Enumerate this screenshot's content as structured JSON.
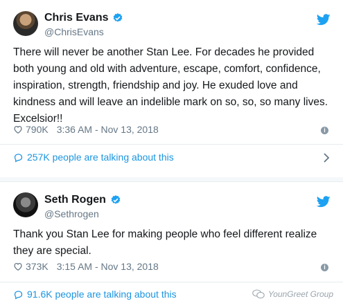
{
  "tweets": [
    {
      "name": "Chris Evans",
      "handle": "@ChrisEvans",
      "text": "There will never be another Stan Lee. For decades he provided both young and old with adventure, escape, comfort, confidence, inspiration, strength, friendship and joy. He exuded love and kindness and will leave an indelible mark on so, so, so many lives. Excelsior!!",
      "likes": "790K",
      "timestamp": "3:36 AM - Nov 13, 2018",
      "talking": "257K people are talking about this"
    },
    {
      "name": "Seth Rogen",
      "handle": "@Sethrogen",
      "text": "Thank you Stan Lee for making people who feel different realize they are special.",
      "likes": "373K",
      "timestamp": "3:15 AM - Nov 13, 2018",
      "talking": "91.6K people are talking about this"
    }
  ],
  "watermark": "YounGreet Group",
  "icons": {
    "verified": "verified-badge-icon",
    "bird": "twitter-bird-icon",
    "heart": "heart-icon",
    "info": "info-icon",
    "bubble": "speech-bubble-icon",
    "chevron": "chevron-right-icon"
  },
  "colors": {
    "accent": "#1da1f2",
    "link": "#1b95e0",
    "secondary_text": "#657786",
    "primary_text": "#14171a"
  }
}
